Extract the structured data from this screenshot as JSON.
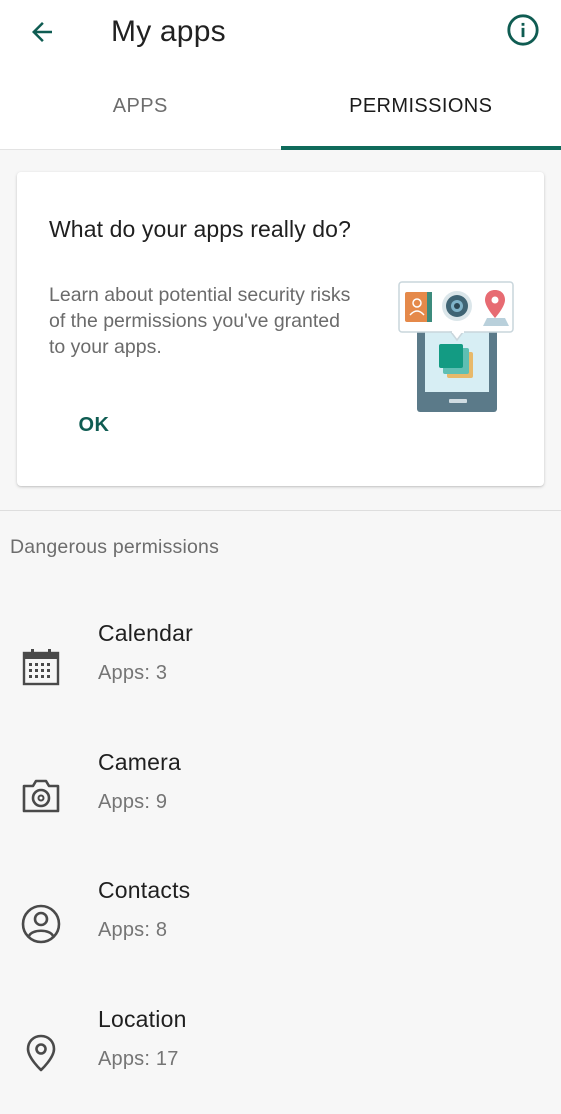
{
  "header": {
    "title": "My apps",
    "back_icon": "arrow-back-icon",
    "info_icon": "info-icon"
  },
  "tabs": [
    {
      "label": "APPS",
      "active": false
    },
    {
      "label": "PERMISSIONS",
      "active": true
    }
  ],
  "card": {
    "title": "What do your apps really do?",
    "body": "Learn about potential security risks of the permissions you've granted to your apps.",
    "ok_label": "OK",
    "illustration_icon": "phone-permissions-illustration"
  },
  "section": {
    "header": "Dangerous permissions"
  },
  "permissions": [
    {
      "name": "Calendar",
      "count": "Apps: 3",
      "icon": "calendar-icon"
    },
    {
      "name": "Camera",
      "count": "Apps: 9",
      "icon": "camera-icon"
    },
    {
      "name": "Contacts",
      "count": "Apps: 8",
      "icon": "contacts-icon"
    },
    {
      "name": "Location",
      "count": "Apps: 17",
      "icon": "location-icon"
    }
  ],
  "colors": {
    "accent": "#0f6b5b",
    "ok_text": "#0f5c52",
    "icon_gray": "#4a4a4a",
    "background": "#f7f7f7"
  }
}
